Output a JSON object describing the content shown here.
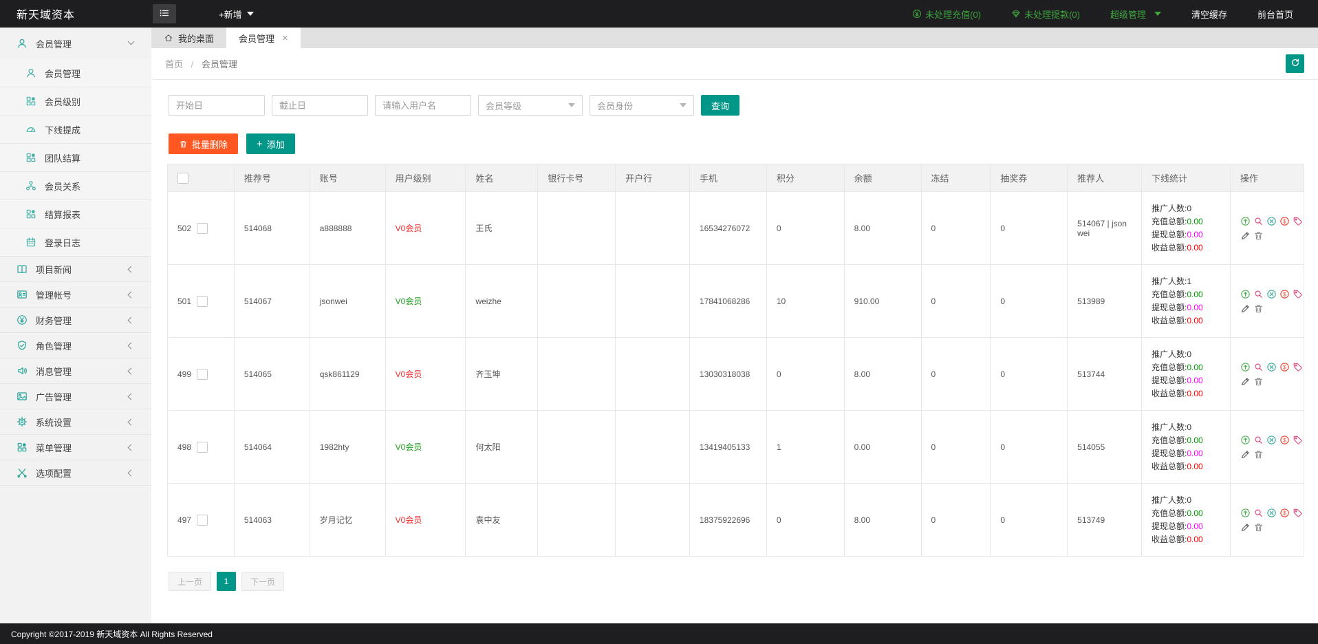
{
  "navbar": {
    "brand": "新天域资本",
    "add_new": "+新增",
    "pending_recharge": "未处理充值(0)",
    "pending_withdraw": "未处理提款(0)",
    "admin_menu": "超级管理",
    "clear_cache": "清空缓存",
    "front_home": "前台首页"
  },
  "sidebar": {
    "items": [
      {
        "label": "会员管理",
        "icon": "user",
        "type": "parent",
        "chevron": "down"
      },
      {
        "label": "会员管理",
        "icon": "user",
        "type": "sub"
      },
      {
        "label": "会员级别",
        "icon": "grid",
        "type": "sub"
      },
      {
        "label": "下线提成",
        "icon": "gauge",
        "type": "sub"
      },
      {
        "label": "团队结算",
        "icon": "grid",
        "type": "sub"
      },
      {
        "label": "会员关系",
        "icon": "tree",
        "type": "sub"
      },
      {
        "label": "结算报表",
        "icon": "grid",
        "type": "sub"
      },
      {
        "label": "登录日志",
        "icon": "calendar",
        "type": "sub"
      },
      {
        "label": "项目新闻",
        "icon": "book",
        "type": "collapsed",
        "chevron": "left"
      },
      {
        "label": "管理帐号",
        "icon": "id",
        "type": "collapsed",
        "chevron": "left"
      },
      {
        "label": "财务管理",
        "icon": "yen",
        "type": "collapsed",
        "chevron": "left"
      },
      {
        "label": "角色管理",
        "icon": "shield",
        "type": "collapsed",
        "chevron": "left"
      },
      {
        "label": "消息管理",
        "icon": "speaker",
        "type": "collapsed",
        "chevron": "left"
      },
      {
        "label": "广告管理",
        "icon": "image",
        "type": "collapsed",
        "chevron": "left"
      },
      {
        "label": "系统设置",
        "icon": "gear",
        "type": "collapsed",
        "chevron": "left"
      },
      {
        "label": "菜单管理",
        "icon": "grid",
        "type": "collapsed",
        "chevron": "left"
      },
      {
        "label": "选项配置",
        "icon": "tools",
        "type": "collapsed",
        "chevron": "left"
      }
    ]
  },
  "tabs": [
    {
      "label": "我的桌面",
      "icon": "home",
      "active": false
    },
    {
      "label": "会员管理",
      "active": true,
      "close_icon": "×"
    }
  ],
  "breadcrumb": {
    "home": "首页",
    "separator": "/",
    "current": "会员管理"
  },
  "filters": {
    "start_date_placeholder": "开始日",
    "end_date_placeholder": "截止日",
    "username_placeholder": "请输入用户名",
    "level_select_value": "会员等级",
    "identity_select_value": "会员身份",
    "search_button": "查询"
  },
  "toolbar": {
    "batch_delete": "批量删除",
    "add_icon": "+",
    "add": "添加"
  },
  "table": {
    "headers": [
      "推荐号",
      "账号",
      "用户级别",
      "姓名",
      "银行卡号",
      "开户行",
      "手机",
      "积分",
      "余额",
      "冻结",
      "抽奖券",
      "推荐人",
      "下线统计",
      "操作"
    ],
    "stats_labels": {
      "promote": "推广人数:",
      "recharge": "充值总额:",
      "withdraw": "提现总额:",
      "income": "收益总额:"
    },
    "rows": [
      {
        "id": "502",
        "ref_no": "514068",
        "account": "a888888",
        "level": "V0会员",
        "level_color": "red",
        "name": "王氏",
        "bank_card": "",
        "bank_name": "",
        "phone": "16534276072",
        "points": "0",
        "balance": "8.00",
        "frozen": "0",
        "lottery": "0",
        "referrer": "514067 | json wei",
        "stats": {
          "promote": "0",
          "recharge": "0.00",
          "withdraw": "0.00",
          "income": "0.00"
        }
      },
      {
        "id": "501",
        "ref_no": "514067",
        "account": "jsonwei",
        "level": "V0会员",
        "level_color": "green",
        "name": "weizhe",
        "bank_card": "",
        "bank_name": "",
        "phone": "17841068286",
        "points": "10",
        "balance": "910.00",
        "frozen": "0",
        "lottery": "0",
        "referrer": "513989",
        "stats": {
          "promote": "1",
          "recharge": "0.00",
          "withdraw": "0.00",
          "income": "0.00"
        }
      },
      {
        "id": "499",
        "ref_no": "514065",
        "account": "qsk861129",
        "level": "V0会员",
        "level_color": "red",
        "name": "齐玉坤",
        "bank_card": "",
        "bank_name": "",
        "phone": "13030318038",
        "points": "0",
        "balance": "8.00",
        "frozen": "0",
        "lottery": "0",
        "referrer": "513744",
        "stats": {
          "promote": "0",
          "recharge": "0.00",
          "withdraw": "0.00",
          "income": "0.00"
        }
      },
      {
        "id": "498",
        "ref_no": "514064",
        "account": "1982hty",
        "level": "V0会员",
        "level_color": "green",
        "name": "何太阳",
        "bank_card": "",
        "bank_name": "",
        "phone": "13419405133",
        "points": "1",
        "balance": "0.00",
        "frozen": "0",
        "lottery": "0",
        "referrer": "514055",
        "stats": {
          "promote": "0",
          "recharge": "0.00",
          "withdraw": "0.00",
          "income": "0.00"
        }
      },
      {
        "id": "497",
        "ref_no": "514063",
        "account": "岁月记忆",
        "level": "V0会员",
        "level_color": "red",
        "name": "袁中友",
        "bank_card": "",
        "bank_name": "",
        "phone": "18375922696",
        "points": "0",
        "balance": "8.00",
        "frozen": "0",
        "lottery": "0",
        "referrer": "513749",
        "stats": {
          "promote": "0",
          "recharge": "0.00",
          "withdraw": "0.00",
          "income": "0.00"
        }
      }
    ]
  },
  "pagination": {
    "prev": "上一页",
    "page": "1",
    "next": "下一页"
  },
  "footer": {
    "copyright": "Copyright ©2017-2019 新天域资本 All Rights Reserved"
  },
  "colors": {
    "accent_teal": "#009688",
    "accent_orange": "#FF5722",
    "navbar_green": "#3fa53f",
    "level_red": "#f42a2a",
    "level_green": "#1c9e1c",
    "stat_green": "#009900",
    "stat_magenta": "#ff00ff",
    "stat_red": "#ff0000",
    "sidebar_icon": "#26a69a"
  }
}
